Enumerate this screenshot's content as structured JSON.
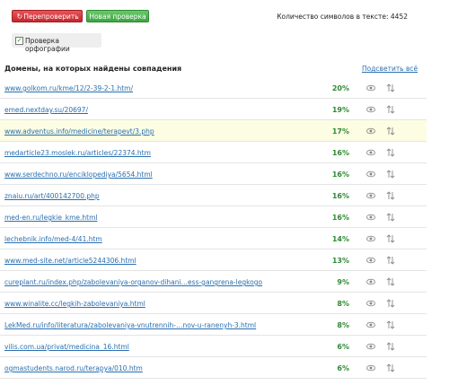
{
  "toolbar": {
    "recheck_icon": "refresh-icon",
    "recheck_label": "Перепроверить",
    "new_check_label": "Новая проверка",
    "char_count_label": "Количество символов в тексте: 4452"
  },
  "spellcheck": {
    "checked": true,
    "label": "Проверка орфографии"
  },
  "results": {
    "title": "Домены, на которых найдены совпадения",
    "highlight_all_label": "Подсветить всё",
    "rows": [
      {
        "url": "www.golkom.ru/kme/12/2-39-2-1.htm/",
        "percent": "20%"
      },
      {
        "url": "emed.nextday.su/20697/",
        "percent": "19%"
      },
      {
        "url": "www.adventus.info/medicine/terapevt/3.php",
        "percent": "17%"
      },
      {
        "url": "medarticle23.moslek.ru/articles/22374.htm",
        "percent": "16%"
      },
      {
        "url": "www.serdechno.ru/enciklopediya/5654.html",
        "percent": "16%"
      },
      {
        "url": "znaiu.ru/art/400142700.php",
        "percent": "16%"
      },
      {
        "url": "med-en.ru/legkie_kme.html",
        "percent": "16%"
      },
      {
        "url": "lechebnik.info/med-4/41.htm",
        "percent": "14%"
      },
      {
        "url": "www.med-site.net/article5244306.html",
        "percent": "13%"
      },
      {
        "url": "cureplant.ru/index.php/zabolevaniya-organov-dihani…ess-gangrena-legkogo",
        "percent": "9%"
      },
      {
        "url": "www.winalite.cc/legkih-zabolevaniya.html",
        "percent": "8%"
      },
      {
        "url": "LekMed.ru/info/literatura/zabolevaniya-vnutrennih-…nov-u-ranenyh-3.html",
        "percent": "8%"
      },
      {
        "url": "vilis.com.ua/privat/medicina_16.html",
        "percent": "6%"
      },
      {
        "url": "ogmastudents.narod.ru/terapya/010.htm",
        "percent": "6%"
      }
    ]
  },
  "colors": {
    "link": "#2a6fb0",
    "percent": "#2e8b32",
    "recheck_button": "#d23a40",
    "new_check_button": "#4fb455",
    "highlight_row": "#fdfde3"
  }
}
